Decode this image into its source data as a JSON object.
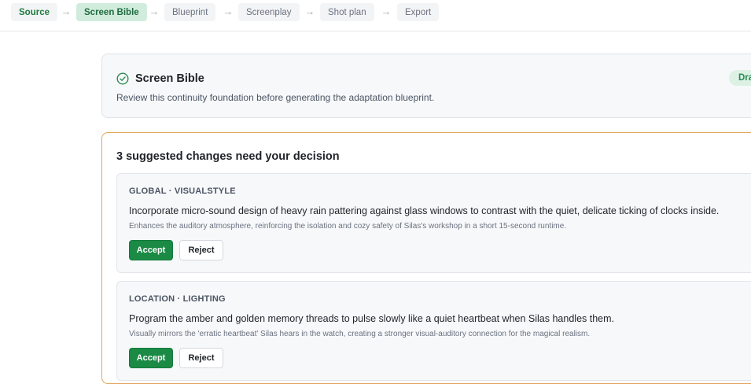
{
  "stepper": {
    "steps": [
      {
        "label": "Source",
        "state": "done"
      },
      {
        "label": "Screen Bible",
        "state": "active"
      },
      {
        "label": "Blueprint",
        "state": "pending"
      },
      {
        "label": "Screenplay",
        "state": "pending"
      },
      {
        "label": "Shot plan",
        "state": "pending"
      },
      {
        "label": "Export",
        "state": "pending"
      }
    ],
    "separator": "→"
  },
  "bible": {
    "title": "Screen Bible",
    "subtitle": "Review this continuity foundation before generating the adaptation blueprint.",
    "badge": "Draft",
    "icon": "check-circle-icon"
  },
  "suggestions": {
    "heading": "3 suggested changes need your decision",
    "changes": [
      {
        "tag": "GLOBAL · VISUALSTYLE",
        "text": "Incorporate micro-sound design of heavy rain pattering against glass windows to contrast with the quiet, delicate ticking of clocks inside.",
        "reason": "Enhances the auditory atmosphere, reinforcing the isolation and cozy safety of Silas's workshop in a short 15-second runtime.",
        "accept_label": "Accept",
        "reject_label": "Reject"
      },
      {
        "tag": "LOCATION · LIGHTING",
        "text": "Program the amber and golden memory threads to pulse slowly like a quiet heartbeat when Silas handles them.",
        "reason": "Visually mirrors the 'erratic heartbeat' Silas hears in the watch, creating a stronger visual-auditory connection for the magical realism.",
        "accept_label": "Accept",
        "reject_label": "Reject"
      }
    ]
  },
  "colors": {
    "accent_green": "#1a8a45",
    "active_step_bg": "#d1ecdd",
    "suggestion_border": "#e0a55a"
  }
}
